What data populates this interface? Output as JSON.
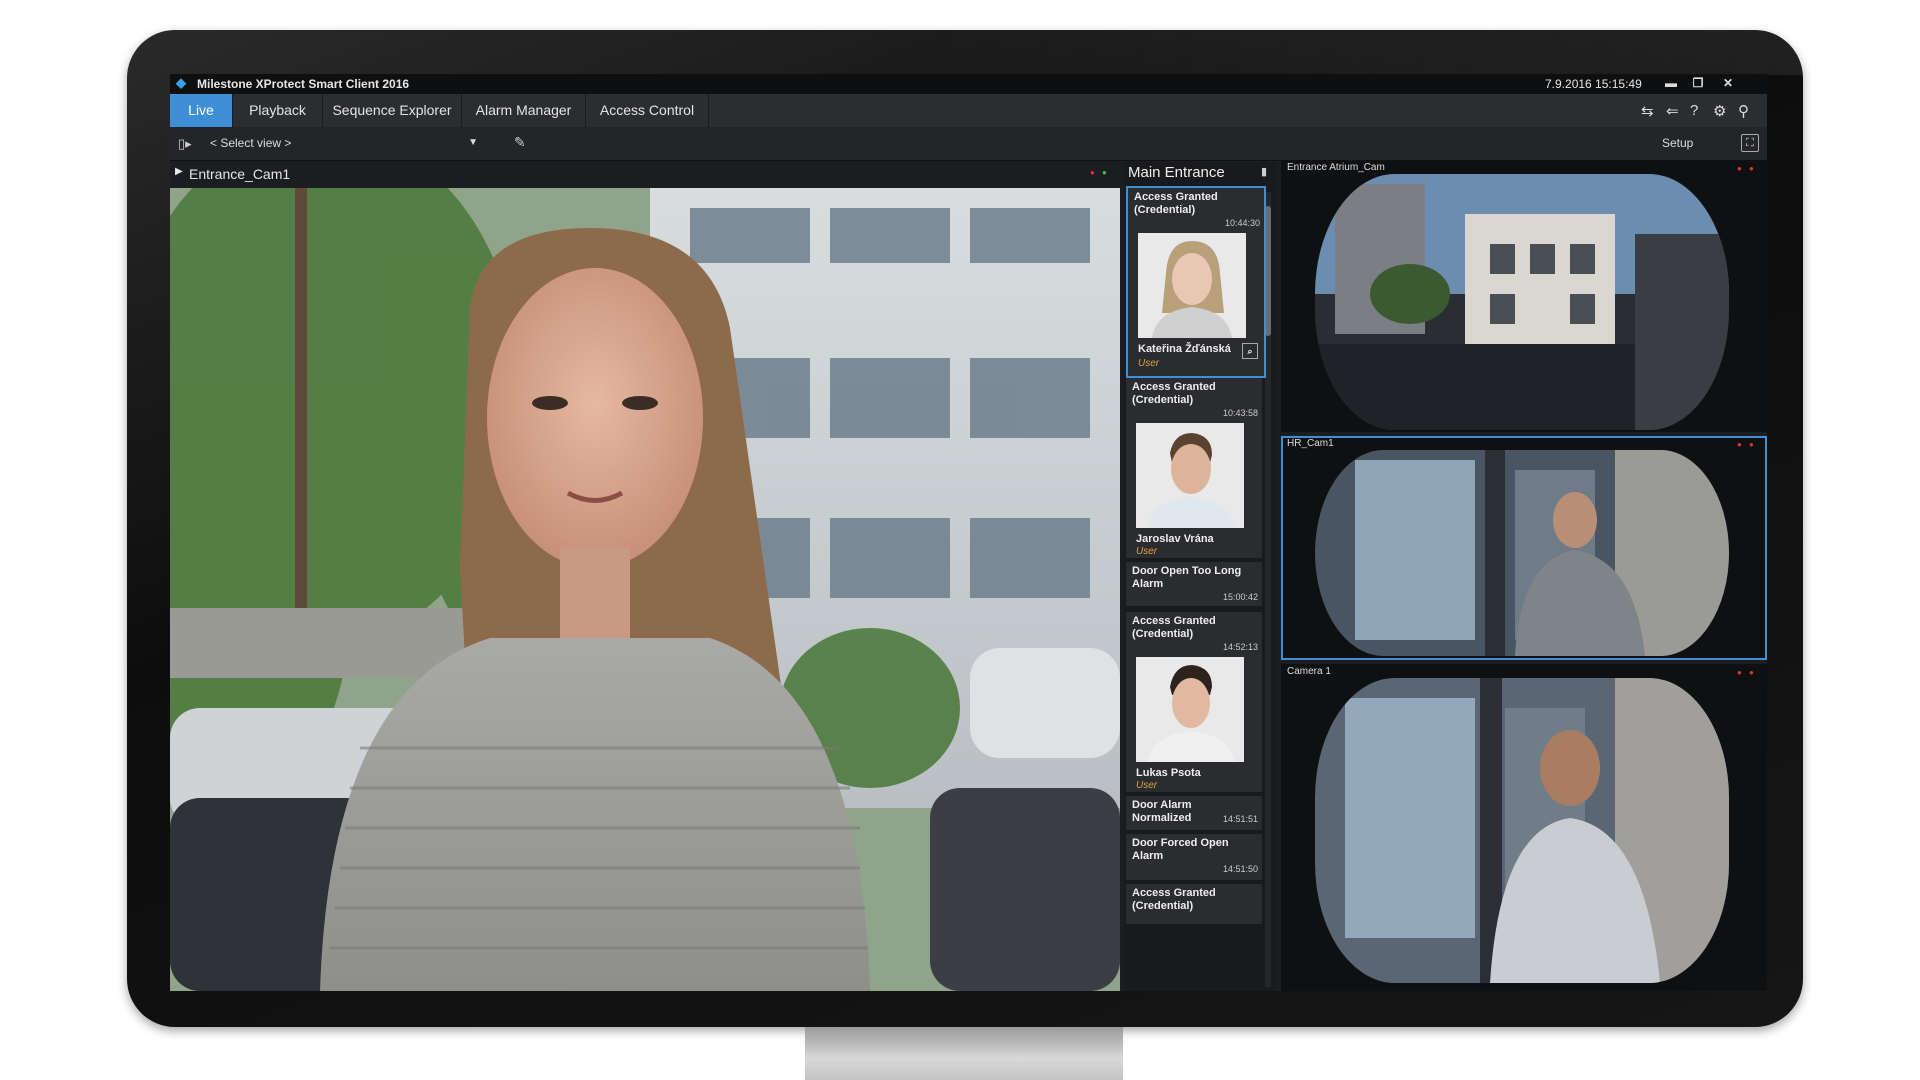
{
  "window": {
    "title": "Milestone XProtect Smart Client 2016",
    "datetime": "7.9.2016 15:15:49"
  },
  "tabs": [
    {
      "label": "Live",
      "active": true
    },
    {
      "label": "Playback"
    },
    {
      "label": "Sequence Explorer"
    },
    {
      "label": "Alarm Manager"
    },
    {
      "label": "Access Control"
    }
  ],
  "viewbar": {
    "select_view": "< Select view >",
    "setup_label": "Setup"
  },
  "main_camera": {
    "name": "Entrance_Cam1"
  },
  "events_panel": {
    "title": "Main Entrance",
    "events": [
      {
        "title": "Access Granted (Credential)",
        "time": "10:44:30",
        "person": "Kateřina Žďánská",
        "role": "User"
      },
      {
        "title": "Access Granted (Credential)",
        "time": "10:43:58",
        "person": "Jaroslav Vrána",
        "role": "User"
      },
      {
        "title": "Door Open Too Long Alarm",
        "time": "15:00:42"
      },
      {
        "title": "Access Granted (Credential)",
        "time": "14:52:13",
        "person": "Lukas Psota",
        "role": "User"
      },
      {
        "title": "Door Alarm Normalized",
        "time": "14:51:51"
      },
      {
        "title": "Door Forced Open Alarm",
        "time": "14:51:50"
      },
      {
        "title": "Access Granted (Credential)"
      }
    ]
  },
  "side_cameras": [
    {
      "name": "Entrance Atrium_Cam"
    },
    {
      "name": "HR_Cam1"
    },
    {
      "name": "Camera 1"
    }
  ],
  "colors": {
    "accent": "#3f8fd6",
    "role": "#e0a040",
    "alert_red": "#e03333",
    "ok_green": "#3fc23f"
  },
  "icons": [
    "diamond-logo-icon",
    "minimize-icon",
    "restore-icon",
    "close-icon",
    "connection-icon",
    "arrow-left-icon",
    "help-icon",
    "gear-icon",
    "pin-icon",
    "view-toggle-icon",
    "dropdown-arrow-icon",
    "edit-icon",
    "maximize-icon",
    "search-icon",
    "camera-flag-icon"
  ]
}
